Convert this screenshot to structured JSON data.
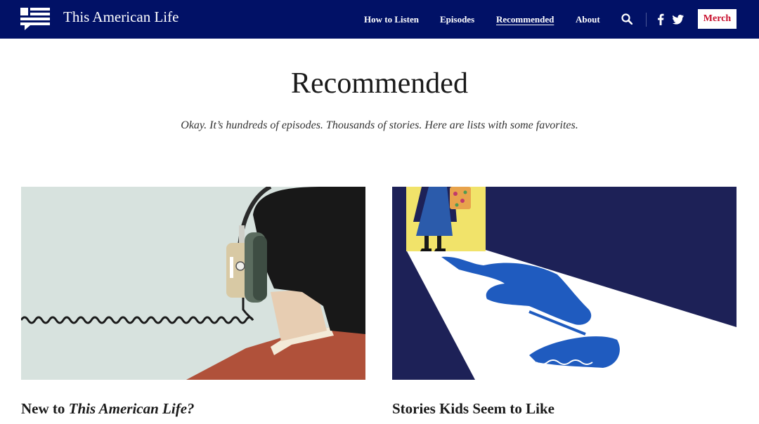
{
  "header": {
    "site_name": "This American Life",
    "nav": [
      {
        "label": "How to Listen",
        "active": false
      },
      {
        "label": "Episodes",
        "active": false
      },
      {
        "label": "Recommended",
        "active": true
      },
      {
        "label": "About",
        "active": false
      }
    ],
    "icons": [
      "logo-icon",
      "search-icon",
      "facebook-icon",
      "twitter-icon"
    ],
    "merch_label": "Merch",
    "colors": {
      "header_bg": "#011166",
      "merch_text": "#c8102e"
    }
  },
  "main": {
    "title": "Recommended",
    "intro": "Okay.  It’s hundreds of episodes. Thousands of stories. Here are lists with some favorites.",
    "cards": [
      {
        "title_prefix": "New to ",
        "title_italic": "This American Life?",
        "image": "illustration of a person wearing headphones with a coiled cord"
      },
      {
        "title": "Stories Kids Seem to Like",
        "image": "illustration of a figure in a doorway casting a long shadow holding an umbrella"
      }
    ]
  }
}
